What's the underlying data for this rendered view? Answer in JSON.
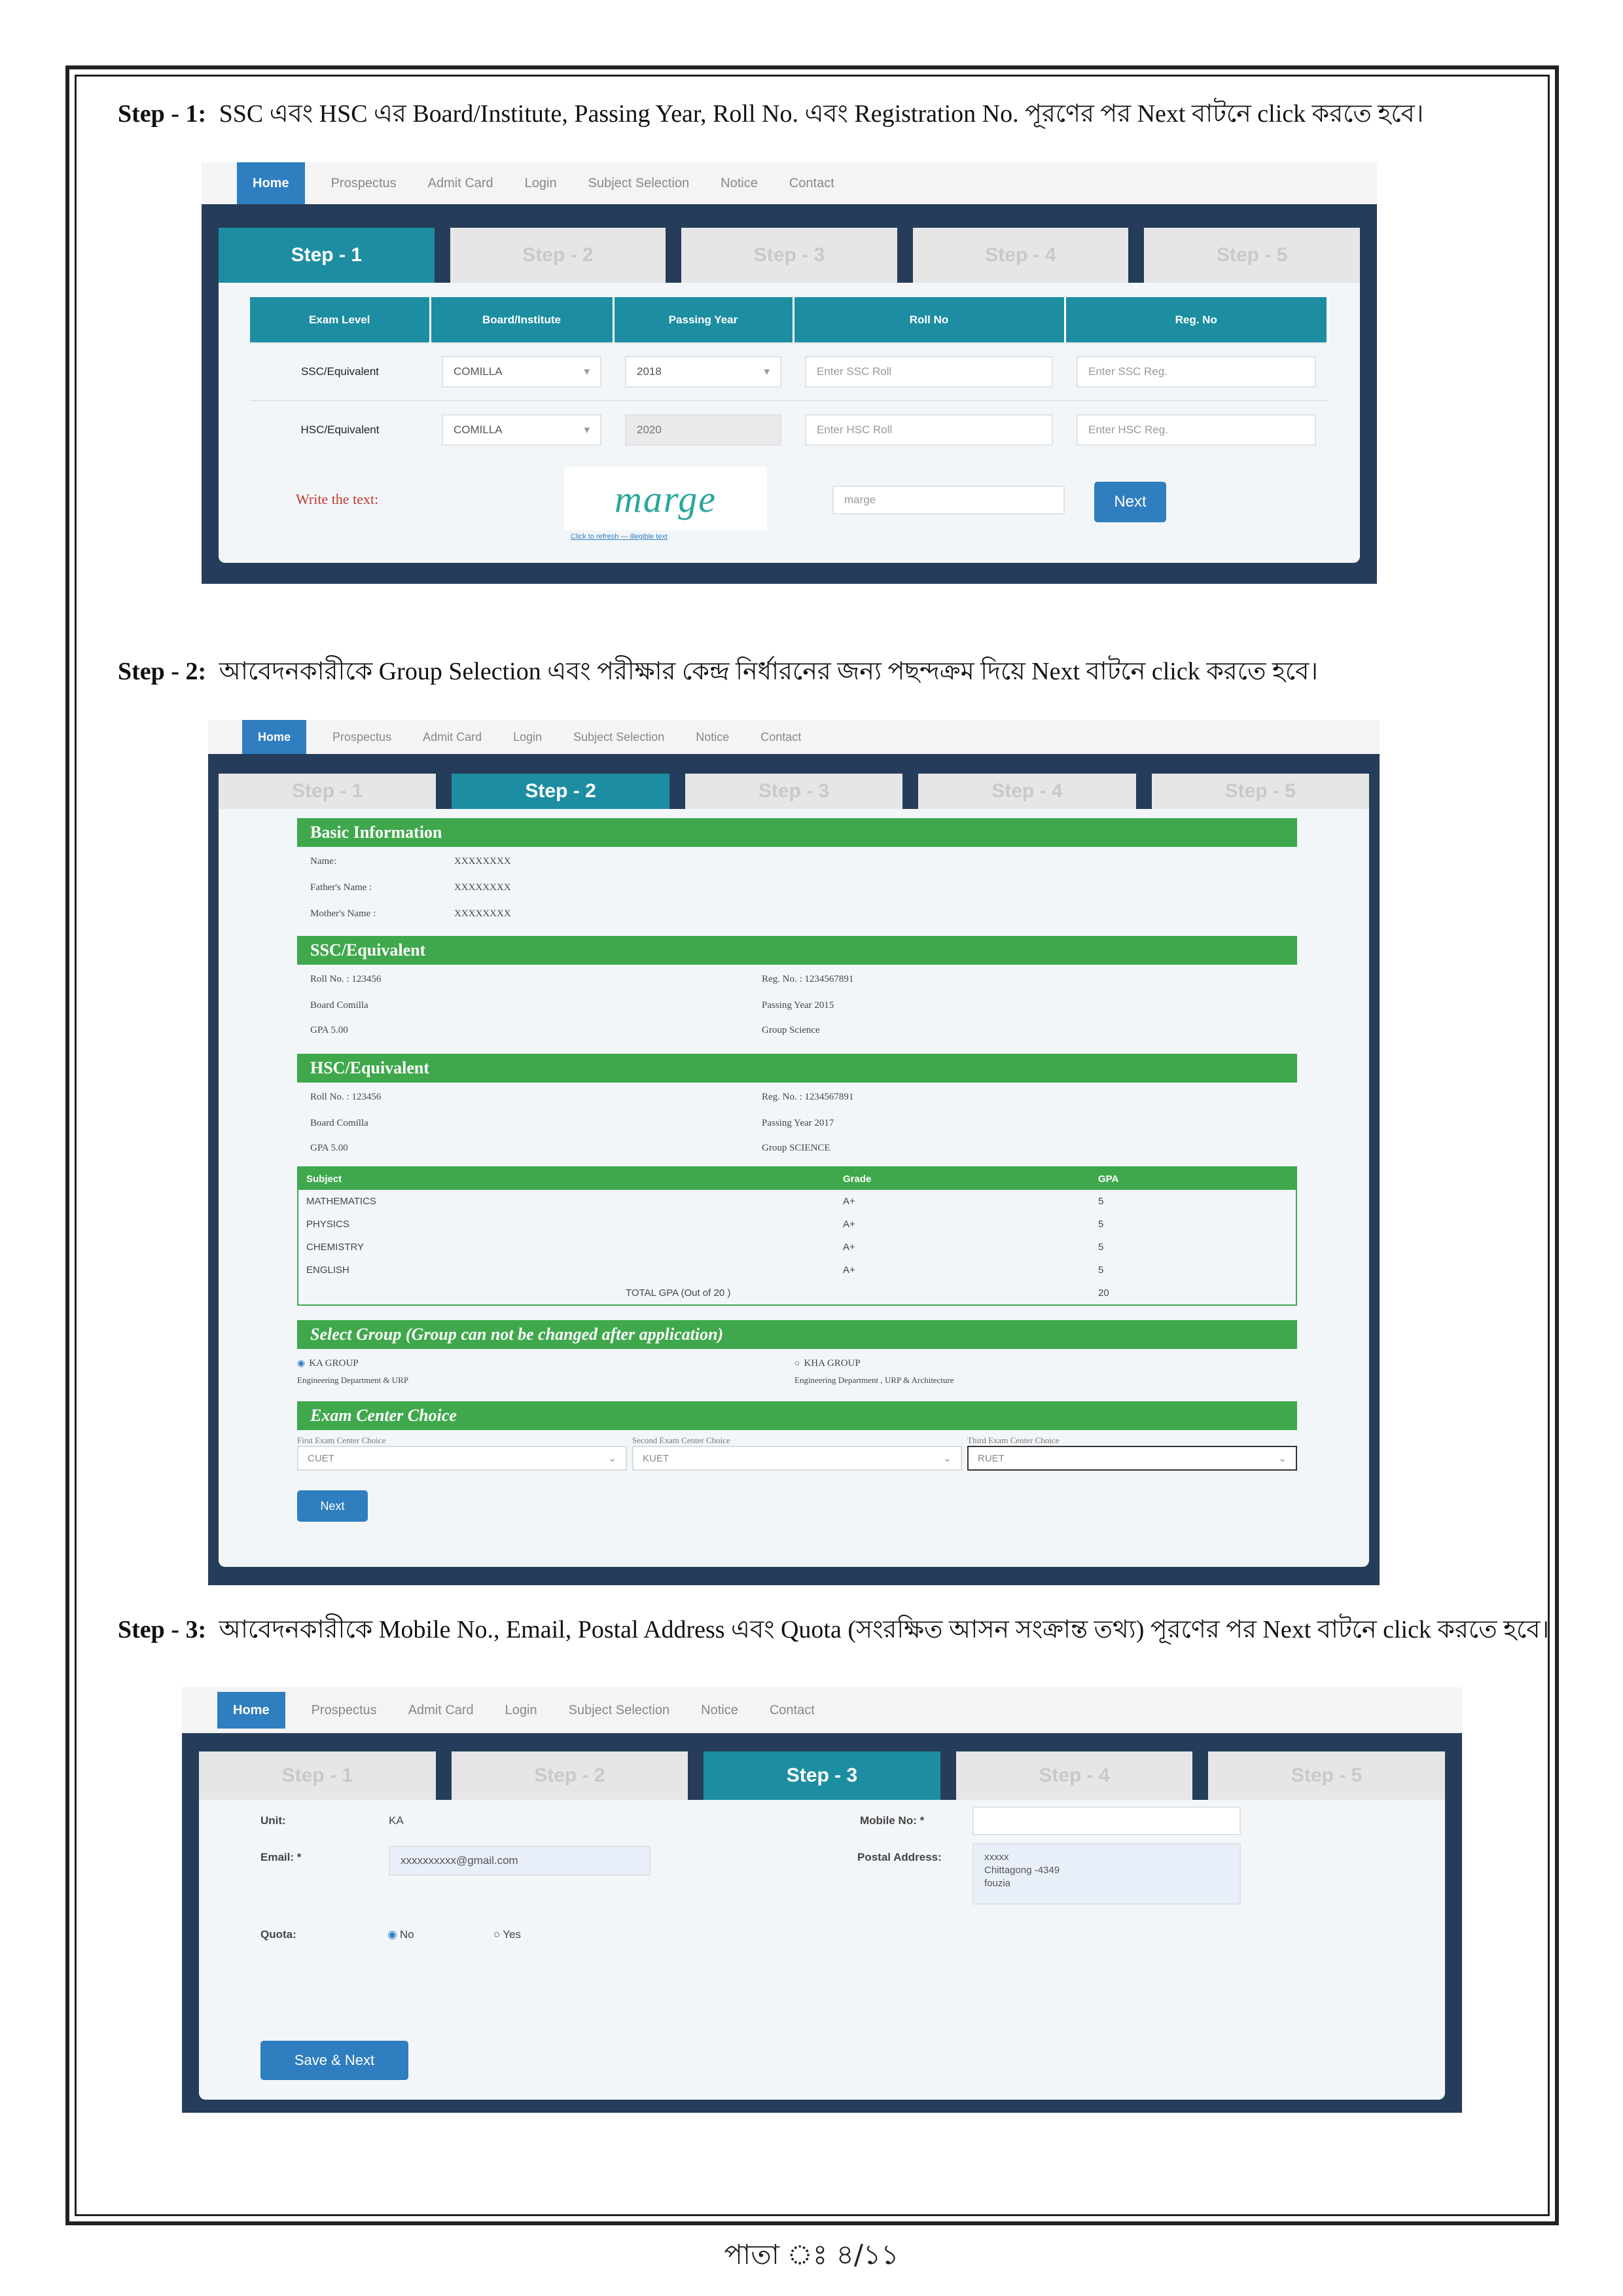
{
  "instructions": {
    "step1": "Step - 1: SSC এবং HSC এর Board/Institute, Passing Year, Roll No. এবং Registration No. পূরণের পর Next বাটনে click করতে হবে।",
    "step2": "Step - 2: আবেদনকারীকে Group Selection এবং পরীক্ষার কেন্দ্র নির্ধারনের জন্য পছন্দক্রম দিয়ে Next বাটনে click করতে হবে।",
    "step3": "Step - 3: আবেদনকারীকে Mobile No., Email, Postal Address এবং Quota (সংরক্ষিত আসন সংক্রান্ত তথ্য) পূরণের পর Next বাটনে click করতে হবে।"
  },
  "nav": {
    "home": "Home",
    "prospectus": "Prospectus",
    "admit": "Admit Card",
    "login": "Login",
    "subject": "Subject Selection",
    "notice": "Notice",
    "contact": "Contact"
  },
  "tabs": [
    "Step - 1",
    "Step - 2",
    "Step - 3",
    "Step - 4",
    "Step - 5"
  ],
  "s1": {
    "headers": [
      "Exam Level",
      "Board/Institute",
      "Passing Year",
      "Roll No",
      "Reg. No"
    ],
    "rows": [
      {
        "level": "SSC/Equivalent",
        "board": "COMILLA",
        "year": "2018",
        "roll_ph": "Enter SSC Roll",
        "reg_ph": "Enter SSC Reg."
      },
      {
        "level": "HSC/Equivalent",
        "board": "COMILLA",
        "year": "2020",
        "roll_ph": "Enter HSC Roll",
        "reg_ph": "Enter HSC Reg."
      }
    ],
    "captcha_label": "Write the text:",
    "captcha_text": "marge",
    "captcha_link": "Click to refresh — illegible text",
    "captcha_input": "marge",
    "next": "Next"
  },
  "s2": {
    "basic": "Basic Information",
    "name_l": "Name:",
    "name_v": "XXXXXXXX",
    "father_l": "Father's Name :",
    "father_v": "XXXXXXXX",
    "mother_l": "Mother's Name :",
    "mother_v": "XXXXXXXX",
    "ssc": "SSC/Equivalent",
    "ssc_roll": "Roll No. : 123456",
    "ssc_reg": "Reg. No. : 1234567891",
    "ssc_board": "Board Comilla",
    "ssc_year": "Passing Year 2015",
    "ssc_gpa": "GPA 5.00",
    "ssc_group": "Group Science",
    "hsc": "HSC/Equivalent",
    "hsc_roll": "Roll No. : 123456",
    "hsc_reg": "Reg. No. : 1234567891",
    "hsc_board": "Board Comilla",
    "hsc_year": "Passing Year 2017",
    "hsc_gpa": "GPA 5.00",
    "hsc_group": "Group SCIENCE",
    "subj_headers": [
      "Subject",
      "Grade",
      "GPA"
    ],
    "subjects": [
      [
        "MATHEMATICS",
        "A+",
        "5"
      ],
      [
        "PHYSICS",
        "A+",
        "5"
      ],
      [
        "CHEMISTRY",
        "A+",
        "5"
      ],
      [
        "ENGLISH",
        "A+",
        "5"
      ]
    ],
    "total_l": "TOTAL GPA (Out of 20 )",
    "total_v": "20",
    "group_title": "Select Group (Group can not be changed after application)",
    "ka": "KA GROUP",
    "ka_desc": "Engineering Department & URP",
    "kha": "KHA GROUP",
    "kha_desc": "Engineering Department , URP & Architecture",
    "center_title": "Exam Center Choice",
    "c1_l": "First Exam Center Choice",
    "c1_v": "CUET",
    "c2_l": "Second Exam Center Choice",
    "c2_v": "KUET",
    "c3_l": "Third Exam Center Choice",
    "c3_v": "RUET",
    "next": "Next"
  },
  "s3": {
    "unit_l": "Unit:",
    "unit_v": "KA",
    "email_l": "Email: *",
    "email_v": "xxxxxxxxxx@gmail.com",
    "mobile_l": "Mobile No: *",
    "postal_l": "Postal Address:",
    "postal_1": "xxxxx",
    "postal_2": "Chittagong -4349",
    "postal_3": "fouzia",
    "quota_l": "Quota:",
    "no": "No",
    "yes": "Yes",
    "save": "Save & Next"
  },
  "page_num": "পাতা ঃ ৪/১১"
}
